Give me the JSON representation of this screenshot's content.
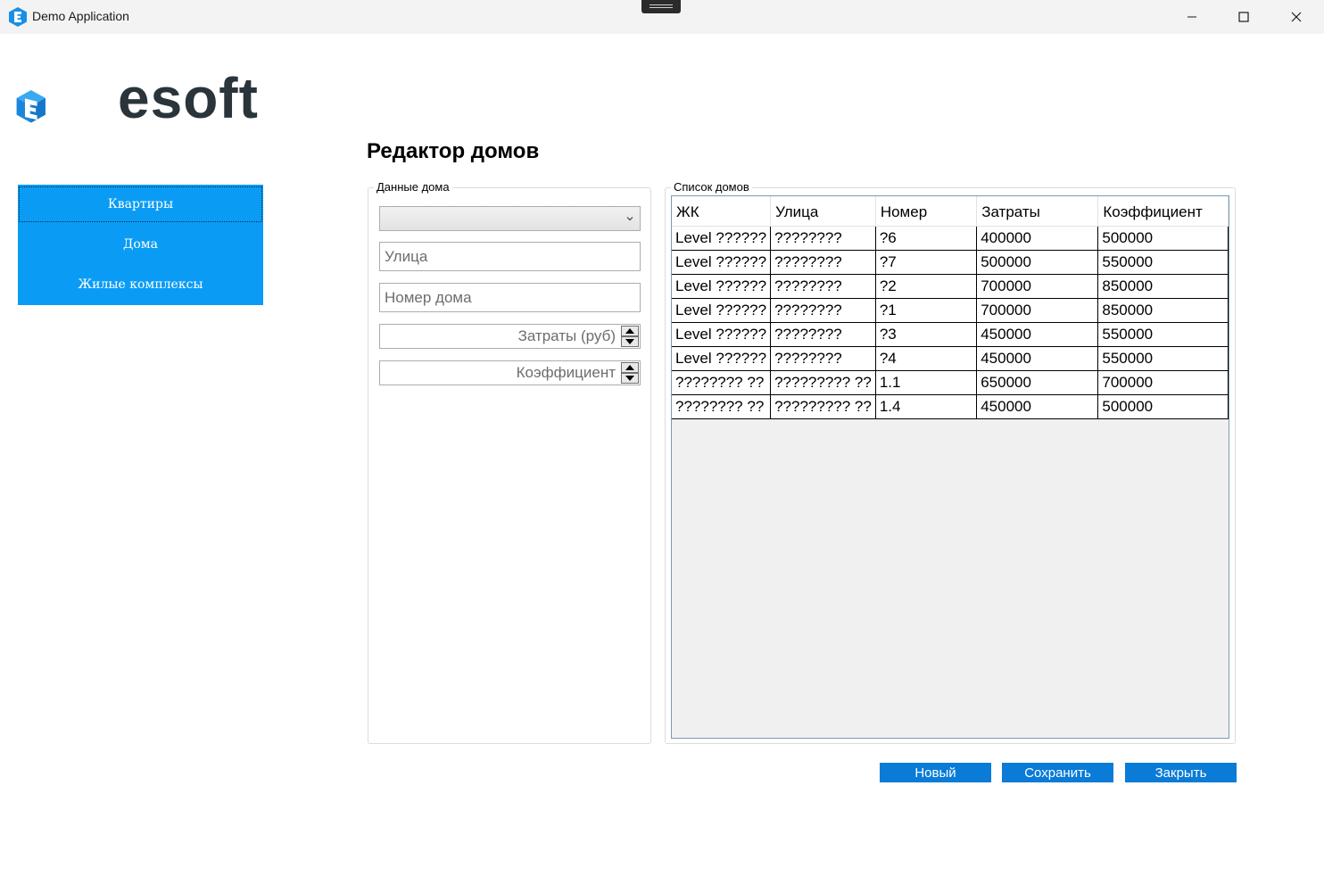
{
  "window": {
    "title": "Demo Application",
    "icons": {
      "app": "esoft-e-icon",
      "minimize": "minimize-icon",
      "maximize": "maximize-icon",
      "close": "close-icon"
    }
  },
  "logo": {
    "text": "esoft"
  },
  "nav": {
    "items": [
      {
        "label": "Квартиры"
      },
      {
        "label": "Дома"
      },
      {
        "label": "Жилые комплексы"
      }
    ]
  },
  "page": {
    "title": "Редактор домов"
  },
  "house_form": {
    "group_label": "Данные дома",
    "complex_select": {
      "value": ""
    },
    "street": {
      "placeholder": "Улица"
    },
    "house_number": {
      "placeholder": "Номер дома"
    },
    "costs": {
      "placeholder": "Затраты (руб)"
    },
    "coefficient": {
      "placeholder": "Коэффициент"
    }
  },
  "house_list": {
    "group_label": "Список домов",
    "columns": [
      "ЖК",
      "Улица",
      "Номер",
      "Затраты",
      "Коэффициент"
    ],
    "rows": [
      [
        "Level ??????",
        "????????",
        "?6",
        "400000",
        "500000"
      ],
      [
        "Level ??????",
        "????????",
        "?7",
        "500000",
        "550000"
      ],
      [
        "Level ??????",
        "????????",
        "?2",
        "700000",
        "850000"
      ],
      [
        "Level ??????",
        "????????",
        "?1",
        "700000",
        "850000"
      ],
      [
        "Level ??????",
        "????????",
        "?3",
        "450000",
        "550000"
      ],
      [
        "Level ??????",
        "????????",
        "?4",
        "450000",
        "550000"
      ],
      [
        "???????? ??",
        "????????? ??",
        "1.1",
        "650000",
        "700000"
      ],
      [
        "???????? ??",
        "????????? ??",
        "1.4",
        "450000",
        "500000"
      ]
    ]
  },
  "actions": {
    "new": "Новый",
    "save": "Сохранить",
    "close": "Закрыть"
  },
  "colors": {
    "nav_bg": "#0a9cf5",
    "button_bg": "#0a7bd7",
    "logo_text": "#2a343b"
  }
}
